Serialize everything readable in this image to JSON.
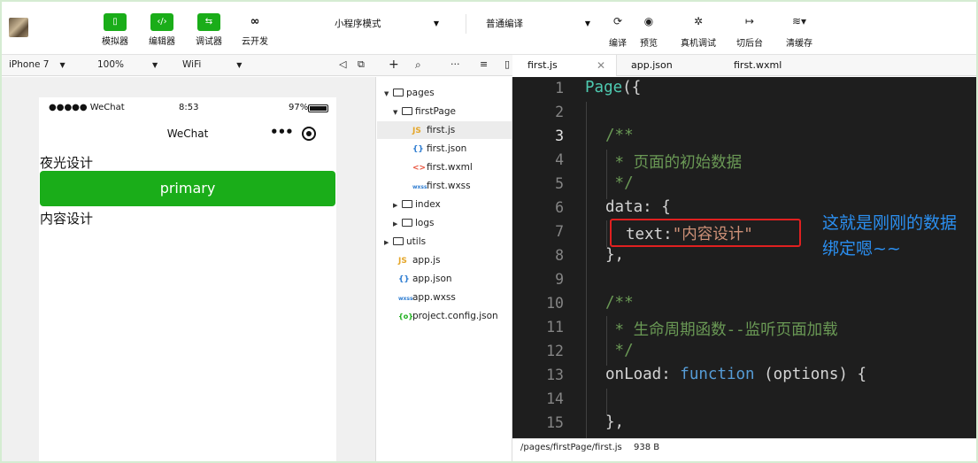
{
  "toolbar": {
    "simulator": "模拟器",
    "editor": "编辑器",
    "debugger": "调试器",
    "cloud": "云开发",
    "mode": "小程序模式",
    "compile_mode": "普通编译",
    "compile": "编译",
    "preview": "预览",
    "remote_debug": "真机调试",
    "background": "切后台",
    "clear_cache": "清缓存"
  },
  "device_bar": {
    "device": "iPhone 7",
    "zoom": "100%",
    "network": "WiFi"
  },
  "tabs": [
    {
      "label": "first.js",
      "active": true
    },
    {
      "label": "app.json",
      "active": false
    },
    {
      "label": "first.wxml",
      "active": false
    }
  ],
  "phone": {
    "carrier": "●●●●● WeChat",
    "time": "8:53",
    "battery": "97%",
    "nav_title": "WeChat",
    "text_line_1": "夜光设计",
    "button_label": "primary",
    "text_line_2": "内容设计"
  },
  "tree": [
    {
      "label": "pages",
      "type": "folder",
      "open": true,
      "depth": 0
    },
    {
      "label": "firstPage",
      "type": "folder",
      "open": true,
      "depth": 1
    },
    {
      "label": "first.js",
      "type": "js",
      "depth": 2,
      "selected": true
    },
    {
      "label": "first.json",
      "type": "json",
      "depth": 2
    },
    {
      "label": "first.wxml",
      "type": "wxml",
      "depth": 2
    },
    {
      "label": "first.wxss",
      "type": "wxss",
      "depth": 2
    },
    {
      "label": "index",
      "type": "folder",
      "open": false,
      "depth": 1
    },
    {
      "label": "logs",
      "type": "folder",
      "open": false,
      "depth": 1
    },
    {
      "label": "utils",
      "type": "folder",
      "open": false,
      "depth": 0
    },
    {
      "label": "app.js",
      "type": "js",
      "depth": 0
    },
    {
      "label": "app.json",
      "type": "json",
      "depth": 0
    },
    {
      "label": "app.wxss",
      "type": "wxss",
      "depth": 0
    },
    {
      "label": "project.config.json",
      "type": "cfg",
      "depth": 0
    }
  ],
  "code": {
    "line_numbers": [
      "1",
      "2",
      "3",
      "4",
      "5",
      "6",
      "7",
      "8",
      "9",
      "10",
      "11",
      "12",
      "13",
      "14",
      "15"
    ],
    "l1_fn": "Page",
    "l1_rest": "({",
    "l3": "/**",
    "l4": " * 页面的初始数据",
    "l5": " */",
    "l6": "data: {",
    "l7_key": "text:",
    "l7_str": "\"内容设计\"",
    "l8": "},",
    "l10": "/**",
    "l11": " * 生命周期函数--监听页面加载",
    "l12": " */",
    "l13_a": "onLoad: ",
    "l13_kw": "function",
    "l13_b": " (options) {",
    "l15": "},"
  },
  "annotation": "这就是刚刚的数据绑定嗯~~",
  "status_bar": {
    "path": "/pages/firstPage/first.js",
    "size": "938 B"
  },
  "colors": {
    "brand_green": "#1aad19",
    "highlight_red": "#e02020",
    "annotation_blue": "#2b8ff0"
  }
}
